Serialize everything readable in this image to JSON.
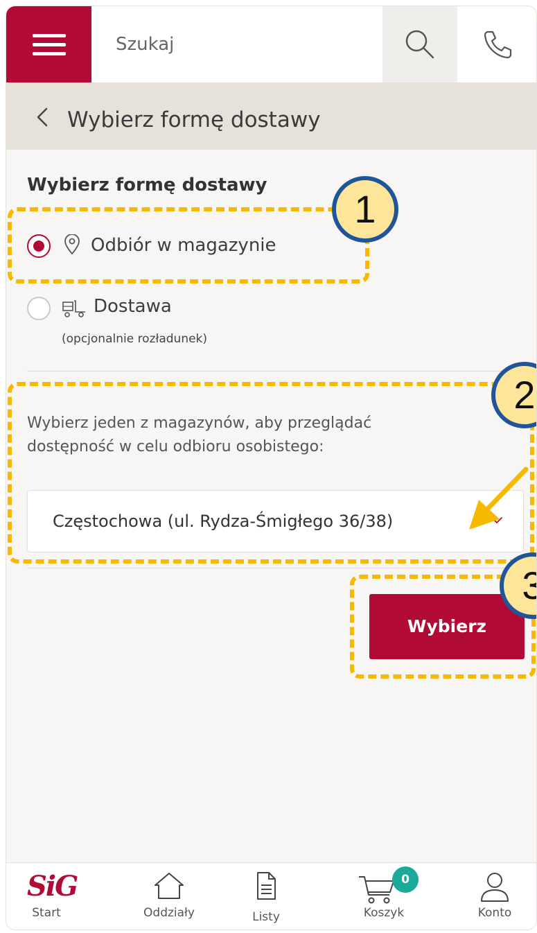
{
  "search": {
    "placeholder": "Szukaj"
  },
  "header": {
    "title": "Wybierz formę dostawy"
  },
  "delivery": {
    "section_title": "Wybierz formę dostawy",
    "options": [
      {
        "label": "Odbiór w magazynie",
        "icon": "location-pin-icon",
        "selected": true
      },
      {
        "label": "Dostawa",
        "sublabel": "(opcjonalnie rozładunek)",
        "icon": "truck-icon",
        "selected": false
      }
    ]
  },
  "warehouse": {
    "instruction": "Wybierz jeden z magazynów, aby przeglądać dostępność w celu odbioru osobistego:",
    "selected": "Częstochowa (ul. Rydza-Śmigłego 36/38)"
  },
  "actions": {
    "choose_label": "Wybierz"
  },
  "annotations": {
    "badge1": "1",
    "badge2": "2",
    "badge3": "3"
  },
  "nav": {
    "logo": "SiG",
    "start": "Start",
    "branches": "Oddziały",
    "lists": "Listy",
    "cart": "Koszyk",
    "cart_count": "0",
    "account": "Konto"
  },
  "colors": {
    "brand": "#b10a35",
    "annotation": "#f7b900",
    "badge_ring": "#21559a",
    "cart_badge": "#1aa99a"
  }
}
